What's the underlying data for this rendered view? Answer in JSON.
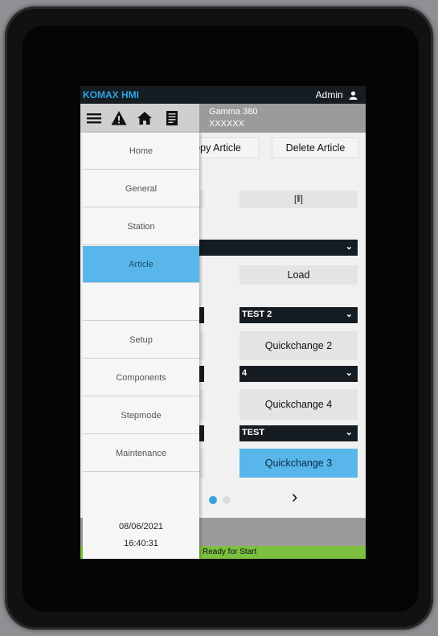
{
  "topbar": {
    "brand": "KOMAX HMI",
    "user": "Admin"
  },
  "toolbar": {
    "machine_line1": "Gamma 380",
    "machine_line2": "XXXXXX"
  },
  "content": {
    "copy_article": "Copy Article",
    "delete_article": "Delete Article",
    "scan_icon_glyph": "[⦀]",
    "load": "Load",
    "select_test2": "TEST 2",
    "quickchange_2": "Quickchange 2",
    "select_4": "4",
    "quickchange_4": "Quickchange 4",
    "select_test": "TEST",
    "quickchange_3": "Quickchange 3",
    "next_glyph": "›"
  },
  "menu": {
    "items": [
      "Home",
      "General",
      "Station",
      "Article",
      "",
      "Setup",
      "Components",
      "Stepmode",
      "Maintenance"
    ],
    "active": "Article",
    "date": "08/06/2021",
    "time": "16:40:31"
  },
  "status": {
    "text": "Ready for Start"
  },
  "colors": {
    "accent": "#58b6ea",
    "brand": "#2ea3e3",
    "dark": "#151c22",
    "status_ok": "#7bc13f"
  }
}
